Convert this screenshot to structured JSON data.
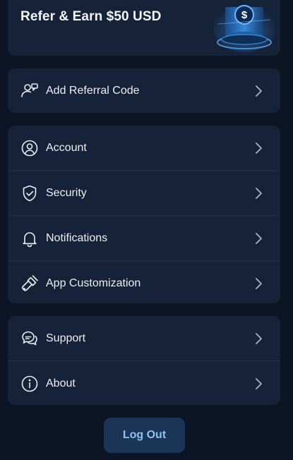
{
  "promo": {
    "title": "Refer & Earn $50 USD",
    "coin_symbol": "$",
    "icon": "coin-cylinder-illustration"
  },
  "referral": {
    "label": "Add Referral Code",
    "icon": "user-add-icon"
  },
  "account_group": [
    {
      "label": "Account",
      "icon": "user-circle-icon"
    },
    {
      "label": "Security",
      "icon": "shield-check-icon"
    },
    {
      "label": "Notifications",
      "icon": "bell-icon"
    },
    {
      "label": "App Customization",
      "icon": "paintbrush-icon"
    }
  ],
  "support_group": [
    {
      "label": "Support",
      "icon": "chat-bubbles-icon"
    },
    {
      "label": "About",
      "icon": "info-circle-icon"
    }
  ],
  "logout": {
    "label": "Log Out"
  },
  "colors": {
    "background": "#0b1526",
    "card": "#152237",
    "divider": "#24324a",
    "text": "#eaf0f8",
    "logout_bg": "#1a3556",
    "logout_text": "#8ec2f0",
    "accent": "#1c8cf0"
  }
}
